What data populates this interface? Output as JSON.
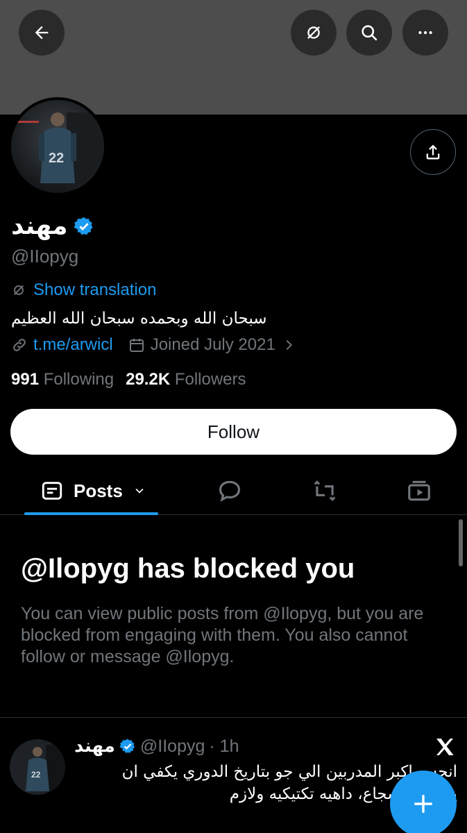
{
  "header": {
    "back_icon": "arrow-left-icon",
    "translate_icon": "translate-icon",
    "search_icon": "search-icon",
    "more_icon": "more-icon"
  },
  "profile": {
    "name": "مهند",
    "verified_icon": "verified-badge-icon",
    "handle": "@IIopyg",
    "show_translation": "Show translation",
    "bio": "سبحان الله وبحمده سبحان الله العظيم",
    "link": "t.me/arwicl",
    "joined": "Joined July 2021",
    "following_count": "991",
    "following_label": "Following",
    "followers_count": "29.2K",
    "followers_label": "Followers",
    "follow_button": "Follow"
  },
  "tabs": {
    "posts_label": "Posts"
  },
  "blocked": {
    "title": "@Ilopyg has blocked you",
    "body": "You can view public posts from @Ilopyg, but you are blocked from engaging with them. You also cannot follow or message @Ilopyg."
  },
  "post": {
    "name": "مهند",
    "handle": "@IIopyg",
    "time": "· 1h",
    "line1": "انحس اكبر المدربين الي جو بتاريخ الدوري يكفي ان",
    "line2": "يسميه الشجاع، داهيه تكتيكيه ولازم"
  },
  "colors": {
    "accent": "#1d9bf0",
    "background": "#000000",
    "banner": "#4d4d4d",
    "muted": "#71767b"
  }
}
